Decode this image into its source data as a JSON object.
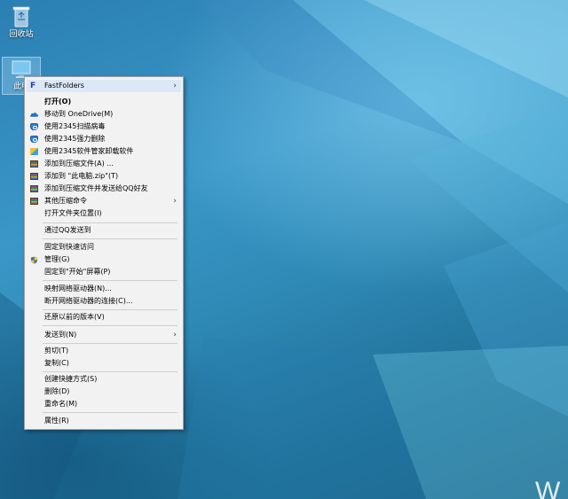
{
  "desktop": {
    "icons": [
      {
        "label": "回收站",
        "icon": "recycle-bin-icon"
      },
      {
        "label": "此电",
        "icon": "this-pc-icon"
      }
    ],
    "corner_text": "W"
  },
  "context_menu": {
    "items": [
      {
        "label": "FastFolders",
        "icon": "fastfolders-icon",
        "submenu": true,
        "highlight": true
      },
      {
        "label": "打开(O)",
        "bold": true
      },
      {
        "label": "移动到 OneDrive(M)",
        "icon": "onedrive-icon"
      },
      {
        "label": "使用2345扫描病毒",
        "icon": "2345-shield-icon"
      },
      {
        "label": "使用2345强力删除",
        "icon": "2345-shield-icon"
      },
      {
        "label": "使用2345软件管家卸载软件",
        "icon": "2345-softmgr-icon"
      },
      {
        "label": "添加到压缩文件(A) ...",
        "icon": "archive-icon"
      },
      {
        "label": "添加到 \"此电脑.zip\"(T)",
        "icon": "archive-icon"
      },
      {
        "label": "添加到压缩文件并发送给QQ好友",
        "icon": "archive-icon"
      },
      {
        "label": "其他压缩命令",
        "icon": "archive-icon",
        "submenu": true
      },
      {
        "label": "打开文件夹位置(I)"
      },
      {
        "label": "通过QQ发送到"
      },
      {
        "label": "固定到快速访问"
      },
      {
        "label": "管理(G)",
        "icon": "admin-shield-icon"
      },
      {
        "label": "固定到\"开始\"屏幕(P)"
      },
      {
        "label": "映射网络驱动器(N)..."
      },
      {
        "label": "断开网络驱动器的连接(C)..."
      },
      {
        "label": "还原以前的版本(V)"
      },
      {
        "label": "发送到(N)",
        "submenu": true
      },
      {
        "label": "剪切(T)"
      },
      {
        "label": "复制(C)"
      },
      {
        "label": "创建快捷方式(S)"
      },
      {
        "label": "删除(D)"
      },
      {
        "label": "重命名(M)"
      },
      {
        "label": "属性(R)"
      }
    ]
  },
  "colors": {
    "menu_background": "#f2f2f2",
    "menu_highlight": "#dce8f5",
    "desktop_blue": "#2a7fb3"
  }
}
